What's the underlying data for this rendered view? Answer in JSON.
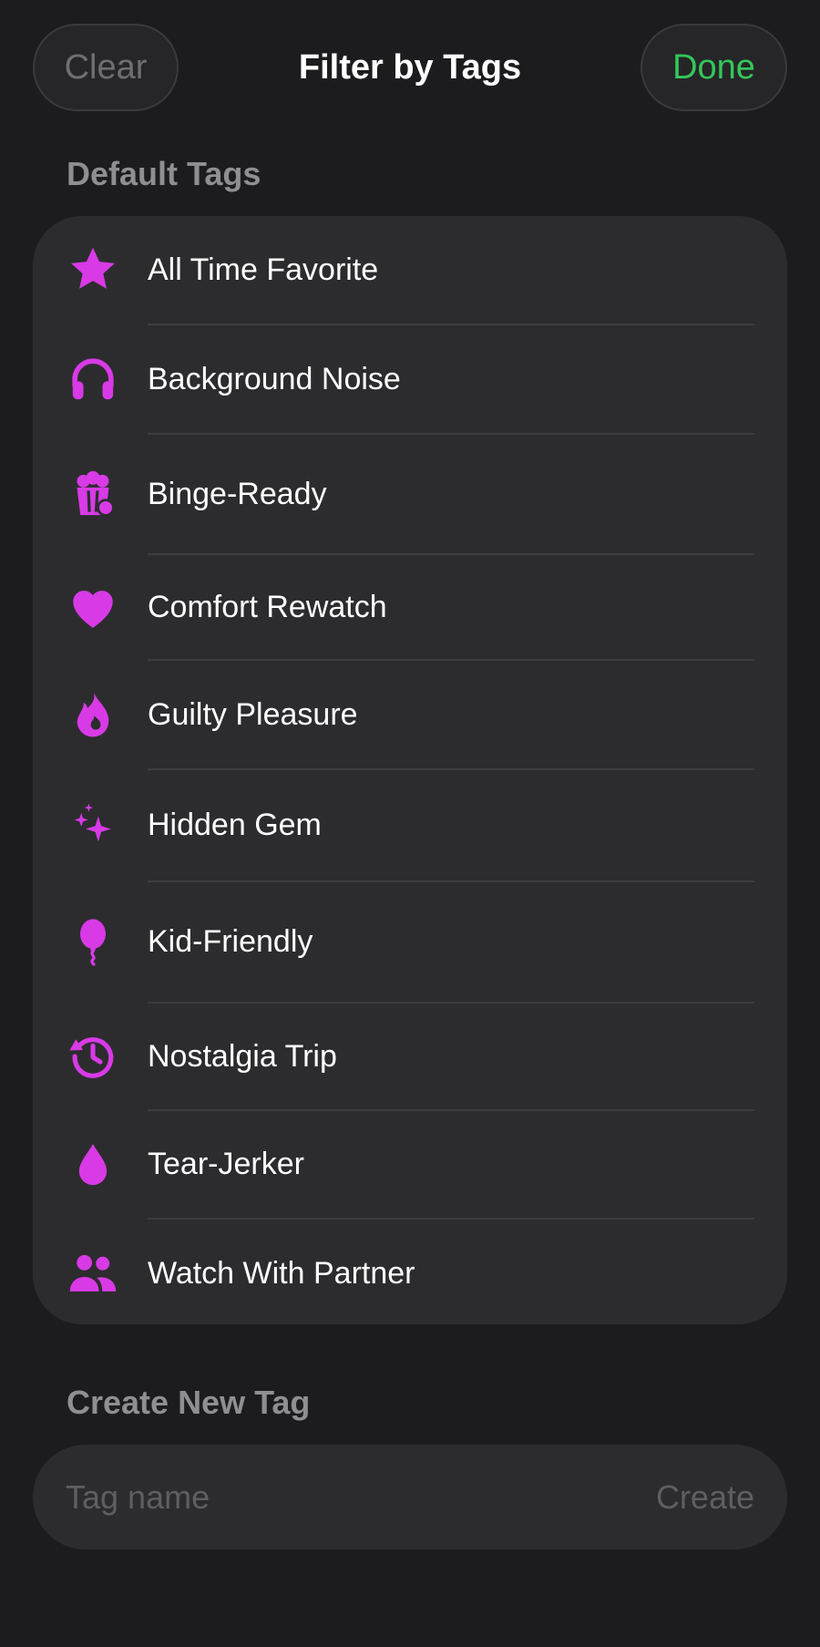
{
  "header": {
    "clear_label": "Clear",
    "title": "Filter by Tags",
    "done_label": "Done"
  },
  "default_tags": {
    "section_label": "Default Tags",
    "items": [
      {
        "label": "All Time Favorite",
        "icon": "star-icon"
      },
      {
        "label": "Background Noise",
        "icon": "headphones-icon"
      },
      {
        "label": "Binge-Ready",
        "icon": "popcorn-icon"
      },
      {
        "label": "Comfort Rewatch",
        "icon": "heart-icon"
      },
      {
        "label": "Guilty Pleasure",
        "icon": "flame-icon"
      },
      {
        "label": "Hidden Gem",
        "icon": "sparkles-icon"
      },
      {
        "label": "Kid-Friendly",
        "icon": "balloon-icon"
      },
      {
        "label": "Nostalgia Trip",
        "icon": "clock-history-icon"
      },
      {
        "label": "Tear-Jerker",
        "icon": "drop-icon"
      },
      {
        "label": "Watch With Partner",
        "icon": "people-icon"
      }
    ]
  },
  "create_tag": {
    "section_label": "Create New Tag",
    "input_value": "",
    "input_placeholder": "Tag name",
    "create_label": "Create"
  },
  "colors": {
    "accent_icon": "#d83ae6",
    "done": "#34c759",
    "background": "#1c1c1e",
    "card": "#2c2c2e"
  }
}
